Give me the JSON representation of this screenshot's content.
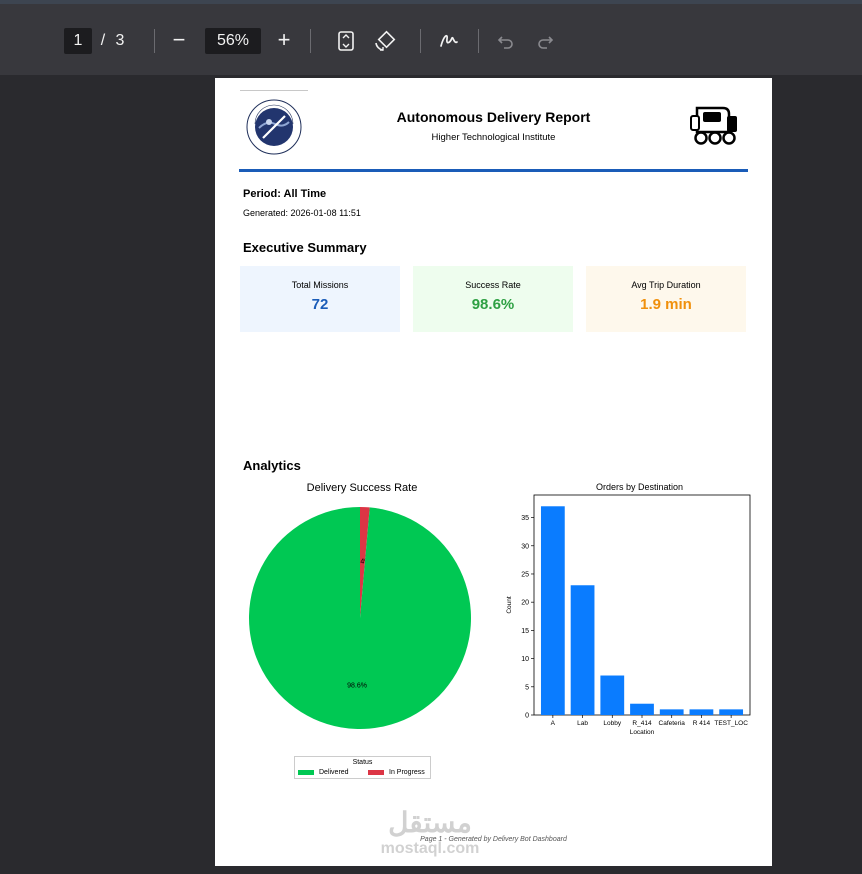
{
  "viewer": {
    "page_current": "1",
    "page_separator": "/",
    "page_total": "3",
    "zoom_out_label": "−",
    "zoom_value": "56%",
    "zoom_in_label": "+",
    "icons": [
      "fit-page-icon",
      "rotate-icon",
      "draw-icon",
      "undo-icon",
      "redo-icon"
    ]
  },
  "report": {
    "title": "Autonomous Delivery Report",
    "subtitle": "Higher Technological Institute",
    "logo_text_top": "Higher Technological Institute",
    "logo_text_bottom": "Tenth of Ramadan City",
    "period": "Period: All Time",
    "generated": "Generated: 2026-01-08 11:51",
    "summary_heading": "Executive Summary",
    "analytics_heading": "Analytics",
    "footer": "Page 1 - Generated by Delivery Bot Dashboard"
  },
  "cards": [
    {
      "label": "Total Missions",
      "value": "72",
      "color": "#1a5cb8",
      "bg": "#eef5fe"
    },
    {
      "label": "Success Rate",
      "value": "98.6%",
      "color": "#2ea043",
      "bg": "#eefdee"
    },
    {
      "label": "Avg Trip Duration",
      "value": "1.9 min",
      "color": "#f0900c",
      "bg": "#fef8ec"
    }
  ],
  "watermark": {
    "arabic": "مستقل",
    "latin": "mostaql.com"
  },
  "chart_data": [
    {
      "type": "pie",
      "title": "Delivery Success Rate",
      "legend_title": "Status",
      "legend_position": "bottom",
      "labels": [
        "Delivered",
        "In Progress"
      ],
      "values": [
        98.6,
        1.4
      ],
      "value_labels": [
        "98.6%",
        "1.4%"
      ],
      "colors": [
        "#00c853",
        "#dc3545"
      ]
    },
    {
      "type": "bar",
      "title": "Orders by Destination",
      "xlabel": "Location",
      "ylabel": "Count",
      "categories": [
        "A",
        "Lab",
        "Lobby",
        "R_414",
        "Cafeteria",
        "R 414",
        "TEST_LOC"
      ],
      "values": [
        37,
        23,
        7,
        2,
        1,
        1,
        1
      ],
      "ylim": [
        0,
        39
      ],
      "yticks": [
        0,
        5,
        10,
        15,
        20,
        25,
        30,
        35
      ],
      "color": "#0a7cff",
      "grid": false
    }
  ]
}
